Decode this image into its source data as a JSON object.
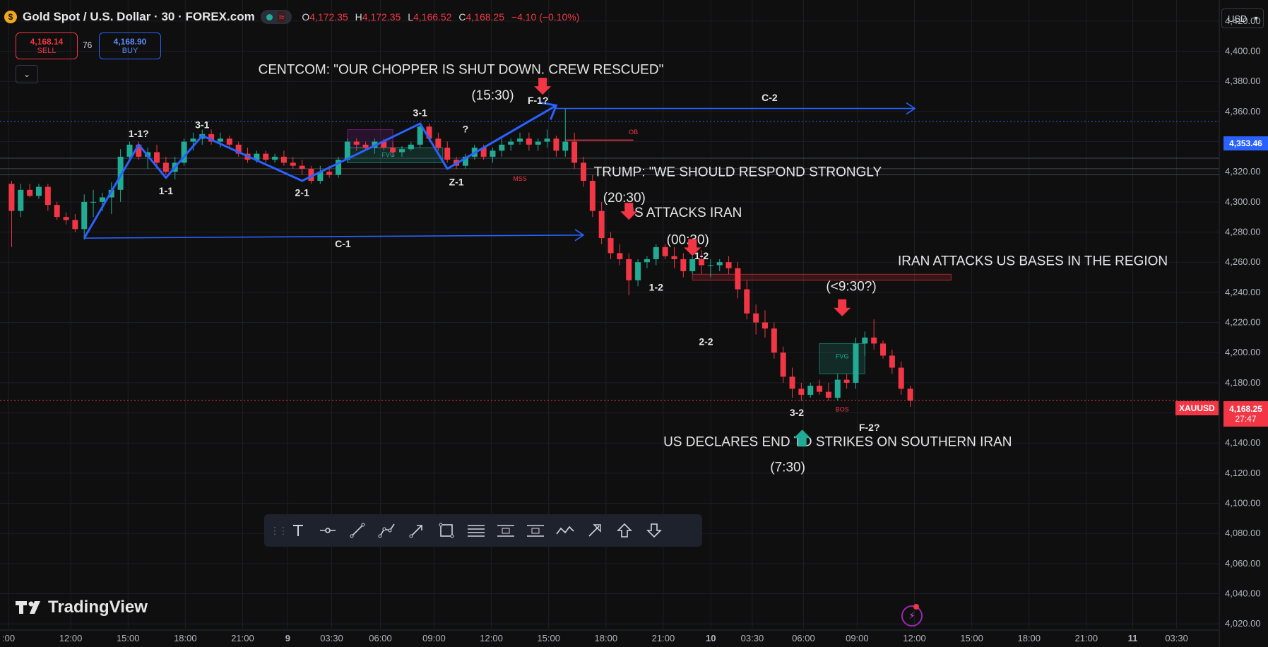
{
  "header": {
    "symbol_title": "Gold Spot / U.S. Dollar · 30 · FOREX.com",
    "gold_icon": "gold-coin-icon",
    "open_label": "O",
    "open": "4,172.35",
    "high_label": "H",
    "high": "4,172.35",
    "low_label": "L",
    "low": "4,166.52",
    "close_label": "C",
    "close": "4,168.25",
    "change": "−4.10 (−0.10%)"
  },
  "trade": {
    "sell_price": "4,168.14",
    "sell_label": "SELL",
    "spread": "76",
    "buy_price": "4,168.90",
    "buy_label": "BUY"
  },
  "currency": "USD",
  "price_axis": {
    "ticks": [
      "4,420.00",
      "4,400.00",
      "4,380.00",
      "4,360.00",
      "4,340.00",
      "4,320.00",
      "4,300.00",
      "4,280.00",
      "4,260.00",
      "4,240.00",
      "4,220.00",
      "4,200.00",
      "4,180.00",
      "4,160.00",
      "4,140.00",
      "4,120.00",
      "4,100.00",
      "4,080.00",
      "4,060.00",
      "4,040.00",
      "4,020.00"
    ],
    "blue_line_label": "4,353.46",
    "symbol_tag": "XAUUSD",
    "current_price": "4,168.25",
    "countdown": "27:47"
  },
  "time_axis": {
    "labels": [
      {
        "text": ":00",
        "pos": 0.007
      },
      {
        "text": "12:00",
        "pos": 0.058
      },
      {
        "text": "15:00",
        "pos": 0.105
      },
      {
        "text": "18:00",
        "pos": 0.152
      },
      {
        "text": "21:00",
        "pos": 0.199
      },
      {
        "text": "9",
        "pos": 0.236
      },
      {
        "text": "03:30",
        "pos": 0.272
      },
      {
        "text": "06:00",
        "pos": 0.312
      },
      {
        "text": "09:00",
        "pos": 0.356
      },
      {
        "text": "12:00",
        "pos": 0.403
      },
      {
        "text": "15:00",
        "pos": 0.45
      },
      {
        "text": "18:00",
        "pos": 0.497
      },
      {
        "text": "21:00",
        "pos": 0.544
      },
      {
        "text": "10",
        "pos": 0.583
      },
      {
        "text": "03:30",
        "pos": 0.617
      },
      {
        "text": "06:00",
        "pos": 0.659
      },
      {
        "text": "09:00",
        "pos": 0.703
      },
      {
        "text": "12:00",
        "pos": 0.75
      },
      {
        "text": "15:00",
        "pos": 0.797
      },
      {
        "text": "18:00",
        "pos": 0.844
      },
      {
        "text": "21:00",
        "pos": 0.891
      },
      {
        "text": "11",
        "pos": 0.929
      },
      {
        "text": "03:30",
        "pos": 0.965
      }
    ]
  },
  "chart_data": {
    "type": "candlestick",
    "ylim": [
      4014,
      4434
    ],
    "xlim": [
      0,
      100
    ],
    "candles": [
      [
        0.5,
        4312,
        4314,
        4270,
        4294
      ],
      [
        1.5,
        4294,
        4312,
        4290,
        4308
      ],
      [
        2.5,
        4308,
        4312,
        4303,
        4304
      ],
      [
        3.5,
        4304,
        4312,
        4302,
        4310
      ],
      [
        4.5,
        4310,
        4312,
        4294,
        4298
      ],
      [
        5.5,
        4298,
        4300,
        4288,
        4290
      ],
      [
        6.5,
        4290,
        4293,
        4285,
        4288
      ],
      [
        7.5,
        4288,
        4292,
        4280,
        4282
      ],
      [
        8.5,
        4282,
        4305,
        4275,
        4300
      ],
      [
        9.5,
        4300,
        4308,
        4290,
        4300
      ],
      [
        10.5,
        4300,
        4306,
        4294,
        4303
      ],
      [
        11.5,
        4303,
        4313,
        4292,
        4308
      ],
      [
        12.5,
        4308,
        4335,
        4300,
        4330
      ],
      [
        13.5,
        4330,
        4340,
        4328,
        4338
      ],
      [
        14.5,
        4338,
        4340,
        4328,
        4330
      ],
      [
        15.5,
        4330,
        4336,
        4322,
        4333
      ],
      [
        16.5,
        4333,
        4338,
        4322,
        4326
      ],
      [
        17.5,
        4326,
        4330,
        4318,
        4320
      ],
      [
        18.5,
        4320,
        4330,
        4315,
        4326
      ],
      [
        19.5,
        4326,
        4342,
        4324,
        4340
      ],
      [
        20.5,
        4340,
        4346,
        4334,
        4342
      ],
      [
        21.5,
        4342,
        4348,
        4338,
        4345
      ],
      [
        22.5,
        4345,
        4348,
        4338,
        4340
      ],
      [
        23.5,
        4340,
        4346,
        4336,
        4342
      ],
      [
        24.5,
        4342,
        4344,
        4336,
        4338
      ],
      [
        25.5,
        4338,
        4340,
        4330,
        4332
      ],
      [
        26.5,
        4332,
        4336,
        4326,
        4328
      ],
      [
        27.5,
        4328,
        4334,
        4326,
        4332
      ],
      [
        28.5,
        4332,
        4334,
        4326,
        4328
      ],
      [
        29.5,
        4328,
        4332,
        4326,
        4330
      ],
      [
        30.5,
        4330,
        4334,
        4324,
        4326
      ],
      [
        31.5,
        4326,
        4330,
        4322,
        4324
      ],
      [
        32.5,
        4324,
        4328,
        4318,
        4322
      ],
      [
        33.5,
        4322,
        4324,
        4312,
        4314
      ],
      [
        34.5,
        4314,
        4324,
        4312,
        4320
      ],
      [
        35.5,
        4320,
        4324,
        4316,
        4318
      ],
      [
        36.5,
        4318,
        4330,
        4316,
        4328
      ],
      [
        37.5,
        4328,
        4342,
        4326,
        4340
      ],
      [
        38.5,
        4340,
        4342,
        4334,
        4338
      ],
      [
        39.5,
        4338,
        4340,
        4334,
        4336
      ],
      [
        40.5,
        4336,
        4342,
        4332,
        4340
      ],
      [
        41.5,
        4340,
        4342,
        4334,
        4336
      ],
      [
        42.5,
        4336,
        4340,
        4330,
        4333
      ],
      [
        43.5,
        4333,
        4337,
        4330,
        4335
      ],
      [
        44.5,
        4335,
        4340,
        4334,
        4338
      ],
      [
        45.5,
        4338,
        4352,
        4336,
        4350
      ],
      [
        46.5,
        4350,
        4352,
        4340,
        4342
      ],
      [
        47.5,
        4342,
        4346,
        4334,
        4336
      ],
      [
        48.5,
        4336,
        4340,
        4326,
        4328
      ],
      [
        49.5,
        4328,
        4330,
        4322,
        4324
      ],
      [
        50.5,
        4324,
        4332,
        4322,
        4330
      ],
      [
        51.5,
        4330,
        4338,
        4328,
        4336
      ],
      [
        52.5,
        4336,
        4338,
        4328,
        4330
      ],
      [
        53.5,
        4330,
        4336,
        4326,
        4334
      ],
      [
        54.5,
        4334,
        4342,
        4330,
        4338
      ],
      [
        55.5,
        4338,
        4342,
        4334,
        4340
      ],
      [
        56.5,
        4340,
        4346,
        4338,
        4342
      ],
      [
        57.5,
        4342,
        4346,
        4334,
        4338
      ],
      [
        58.5,
        4338,
        4342,
        4334,
        4340
      ],
      [
        59.5,
        4340,
        4348,
        4336,
        4342
      ],
      [
        60.5,
        4342,
        4344,
        4330,
        4334
      ],
      [
        61.5,
        4334,
        4362,
        4330,
        4340
      ],
      [
        62.5,
        4340,
        4346,
        4322,
        4326
      ],
      [
        63.5,
        4326,
        4330,
        4310,
        4314
      ],
      [
        64.5,
        4314,
        4318,
        4290,
        4294
      ],
      [
        65.5,
        4294,
        4300,
        4272,
        4276
      ],
      [
        66.5,
        4276,
        4280,
        4262,
        4266
      ],
      [
        67.5,
        4266,
        4272,
        4258,
        4262
      ],
      [
        68.5,
        4262,
        4266,
        4238,
        4248
      ],
      [
        69.5,
        4248,
        4262,
        4244,
        4260
      ],
      [
        70.5,
        4260,
        4264,
        4256,
        4262
      ],
      [
        71.5,
        4262,
        4272,
        4258,
        4270
      ],
      [
        72.5,
        4270,
        4272,
        4262,
        4264
      ],
      [
        73.5,
        4264,
        4270,
        4256,
        4262
      ],
      [
        74.5,
        4262,
        4266,
        4250,
        4254
      ],
      [
        75.5,
        4254,
        4264,
        4252,
        4262
      ],
      [
        76.5,
        4262,
        4268,
        4252,
        4258
      ],
      [
        77.5,
        4258,
        4262,
        4250,
        4258
      ],
      [
        78.5,
        4258,
        4262,
        4254,
        4260
      ],
      [
        79.5,
        4260,
        4264,
        4252,
        4256
      ],
      [
        80.5,
        4256,
        4260,
        4236,
        4242
      ],
      [
        81.5,
        4242,
        4248,
        4222,
        4226
      ],
      [
        82.5,
        4226,
        4232,
        4212,
        4220
      ],
      [
        83.5,
        4220,
        4228,
        4210,
        4216
      ],
      [
        84.5,
        4216,
        4220,
        4196,
        4200
      ],
      [
        85.5,
        4200,
        4204,
        4180,
        4184
      ],
      [
        86.5,
        4184,
        4190,
        4170,
        4176
      ],
      [
        87.5,
        4176,
        4180,
        4168,
        4172
      ],
      [
        88.5,
        4172,
        4180,
        4170,
        4178
      ],
      [
        89.5,
        4178,
        4182,
        4172,
        4174
      ],
      [
        90.5,
        4174,
        4180,
        4168,
        4170
      ],
      [
        91.5,
        4170,
        4186,
        4168,
        4182
      ],
      [
        92.5,
        4182,
        4186,
        4176,
        4180
      ],
      [
        93.5,
        4180,
        4210,
        4176,
        4206
      ],
      [
        94.5,
        4206,
        4214,
        4198,
        4210
      ],
      [
        95.5,
        4210,
        4222,
        4202,
        4206
      ],
      [
        96.5,
        4206,
        4208,
        4196,
        4198
      ],
      [
        97.5,
        4198,
        4202,
        4186,
        4190
      ],
      [
        98.5,
        4190,
        4194,
        4172,
        4176
      ],
      [
        99.5,
        4176,
        4178,
        4164,
        4168
      ]
    ],
    "wave_lines": [
      {
        "name": "wave-1",
        "points": [
          [
            8.5,
            4276
          ],
          [
            14.5,
            4338
          ],
          [
            17.5,
            4316
          ],
          [
            21.5,
            4344
          ],
          [
            32.5,
            4314
          ],
          [
            45.5,
            4352
          ],
          [
            48.5,
            4322
          ],
          [
            60.5,
            4364
          ]
        ]
      },
      {
        "name": "c1-line",
        "arrow": true,
        "points": [
          [
            8.5,
            4276
          ],
          [
            63.5,
            4278
          ]
        ]
      },
      {
        "name": "c2-line",
        "arrow": true,
        "points": [
          [
            60.5,
            4362
          ],
          [
            100,
            4362
          ]
        ]
      }
    ],
    "horizontal_lines": [
      {
        "name": "blue-dotted-line",
        "price": 4353.46,
        "color": "#2962ff",
        "style": "dotted"
      },
      {
        "name": "grey-line-1",
        "price": 4329,
        "color": "#5d606b",
        "style": "solid"
      },
      {
        "name": "grey-line-2",
        "price": 4322,
        "color": "#5d606b",
        "style": "solid"
      },
      {
        "name": "grey-line-3",
        "price": 4318,
        "color": "#5d606b",
        "style": "solid"
      },
      {
        "name": "current-price-line",
        "price": 4168.25,
        "color": "#f23645",
        "style": "dotted"
      }
    ],
    "wave_labels": [
      {
        "text": "1-1?",
        "x": 14.5,
        "y": 4343
      },
      {
        "text": "1-1",
        "x": 17.5,
        "y": 4305
      },
      {
        "text": "3-1",
        "x": 21.5,
        "y": 4349
      },
      {
        "text": "2-1",
        "x": 32.5,
        "y": 4304
      },
      {
        "text": "3-1",
        "x": 45.5,
        "y": 4357
      },
      {
        "text": "?",
        "x": 50.5,
        "y": 4346
      },
      {
        "text": "Z-1",
        "x": 49.5,
        "y": 4311
      },
      {
        "text": "F-1?",
        "x": 58.5,
        "y": 4365
      },
      {
        "text": "C-1",
        "x": 37,
        "y": 4270
      },
      {
        "text": "C-2",
        "x": 84,
        "y": 4367
      },
      {
        "text": "1-2",
        "x": 76.5,
        "y": 4262
      },
      {
        "text": "1-2",
        "x": 71.5,
        "y": 4241
      },
      {
        "text": "2-2",
        "x": 77,
        "y": 4205
      },
      {
        "text": "3-2",
        "x": 87,
        "y": 4158
      },
      {
        "text": "F-2?",
        "x": 95,
        "y": 4148
      }
    ],
    "small_labels": [
      {
        "text": "OB",
        "x": 69,
        "y": 4345
      },
      {
        "text": "MSS",
        "x": 56.5,
        "y": 4314
      },
      {
        "text": "FVG",
        "x": 42,
        "y": 4330
      },
      {
        "text": "FVG",
        "x": 92,
        "y": 4196
      },
      {
        "text": "BOS",
        "x": 92,
        "y": 4161
      }
    ],
    "zones": [
      {
        "name": "purple-box",
        "x1": 37.5,
        "x2": 42.5,
        "y1": 4336,
        "y2": 4348,
        "color": "#9c27b0"
      },
      {
        "name": "fvg-box-1",
        "x1": 37.5,
        "x2": 48,
        "y1": 4326,
        "y2": 4336,
        "color": "#22ab94"
      },
      {
        "name": "iran-zone",
        "x1": 75.5,
        "x2": 104,
        "y1": 4248,
        "y2": 4252,
        "color": "#f23645"
      },
      {
        "name": "fvg-box-2",
        "x1": 89.5,
        "x2": 94.5,
        "y1": 4186,
        "y2": 4206,
        "color": "#22ab94"
      },
      {
        "name": "ob-line",
        "x1": 61.5,
        "x2": 69,
        "y1": 4341,
        "y2": 4341,
        "color": "#f23645"
      }
    ],
    "annotations": [
      {
        "text": "CENTCOM: \"OUR CHOPPER IS SHUT DOWN. CREW RESCUED\"",
        "x": 50,
        "y": 4385
      },
      {
        "text": "(15:30)",
        "x": 53.5,
        "y": 4368
      },
      {
        "text": "TRUMP: \"WE SHOULD RESPOND STRONGLY",
        "x": 80.5,
        "y": 4317
      },
      {
        "text": "(20:30)",
        "x": 68,
        "y": 4300
      },
      {
        "text": "US ATTACKS IRAN",
        "x": 74.5,
        "y": 4290
      },
      {
        "text": "(00:30)",
        "x": 75,
        "y": 4272
      },
      {
        "text": "IRAN ATTACKS US BASES IN THE REGION",
        "x": 113,
        "y": 4258
      },
      {
        "text": "(<9:30?)",
        "x": 93,
        "y": 4241
      },
      {
        "text": "US DECLARES END TO STRIKES ON SOUTHERN IRAN",
        "x": 91.5,
        "y": 4138
      },
      {
        "text": "(7:30)",
        "x": 86,
        "y": 4121
      }
    ],
    "event_arrows": [
      {
        "name": "centcom-arrow",
        "x": 59,
        "y": 4373,
        "dir": "down",
        "color": "#f23645"
      },
      {
        "name": "trump-arrow",
        "x": 68.5,
        "y": 4290,
        "dir": "down",
        "color": "#f23645"
      },
      {
        "name": "us-attack-arrow",
        "x": 75.5,
        "y": 4266,
        "dir": "down",
        "color": "#f23645"
      },
      {
        "name": "iran-attack-arrow",
        "x": 92,
        "y": 4226,
        "dir": "down",
        "color": "#f23645"
      },
      {
        "name": "us-declares-arrow",
        "x": 87.6,
        "y": 4147,
        "dir": "up",
        "color": "#22ab94"
      }
    ]
  },
  "toolbar": {
    "tools": [
      "text-icon",
      "horizontal-ray-icon",
      "trend-line-icon",
      "path-icon",
      "arrow-line-icon",
      "rectangle-icon",
      "lines-icon",
      "stop-icon",
      "long-icon",
      "polyline-icon",
      "arrow-marker-icon",
      "arrow-up-icon",
      "arrow-down-icon"
    ]
  },
  "branding": "TradingView",
  "colors": {
    "bull": "#22ab94",
    "bear": "#f23645",
    "wave": "#2962ff",
    "background": "#0f0f0f"
  }
}
